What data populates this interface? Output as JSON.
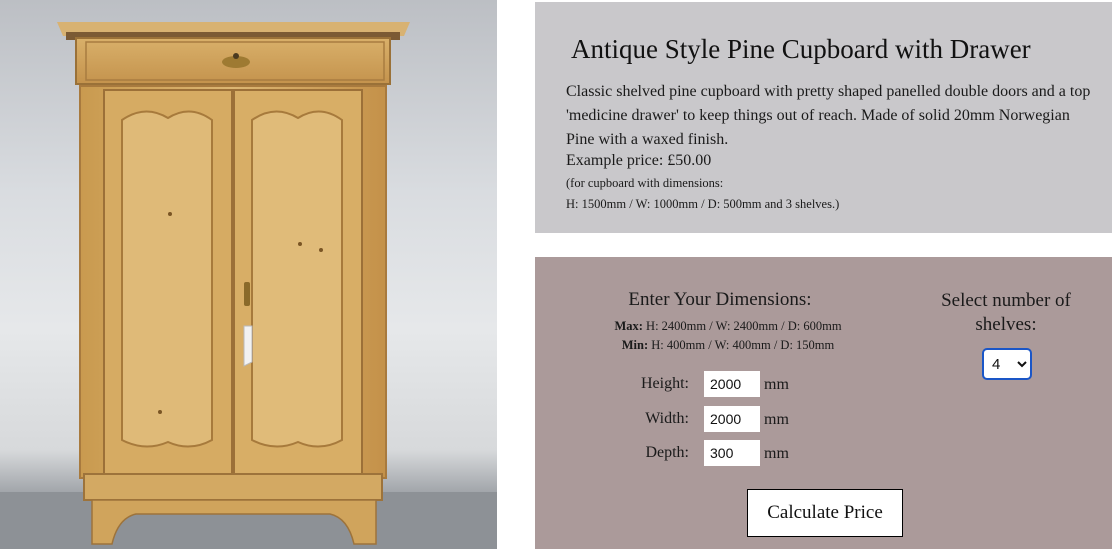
{
  "product": {
    "image_alt": "pine cupboard photo",
    "title": "Antique Style Pine Cupboard with Drawer",
    "description": "Classic shelved pine cupboard with pretty shaped panelled double doors and a top 'medicine drawer' to keep things out of reach. Made of solid 20mm Norwegian Pine with a waxed finish.",
    "example_price": "Example price: £50.00",
    "note_line1": "(for cupboard with dimensions:",
    "note_line2": "H: 1500mm / W: 1000mm / D: 500mm and 3 shelves.)"
  },
  "calculator": {
    "dimensions_title": "Enter Your Dimensions:",
    "max_label": "Max:",
    "max_value": "H: 2400mm / W: 2400mm / D: 600mm",
    "min_label": "Min:",
    "min_value": "H: 400mm / W: 400mm / D: 150mm",
    "fields": [
      {
        "label": "Height:",
        "value": "2000",
        "unit": "mm"
      },
      {
        "label": "Width:",
        "value": "2000",
        "unit": "mm"
      },
      {
        "label": "Depth:",
        "value": "300",
        "unit": "mm"
      }
    ],
    "shelves_title": "Select number of shelves:",
    "shelves_selected": "4",
    "button_label": "Calculate Price"
  },
  "colors": {
    "info_panel_bg": "#c9c8cb",
    "calc_panel_bg": "#ab9a9a",
    "select_focus_border": "#1a56c7"
  }
}
